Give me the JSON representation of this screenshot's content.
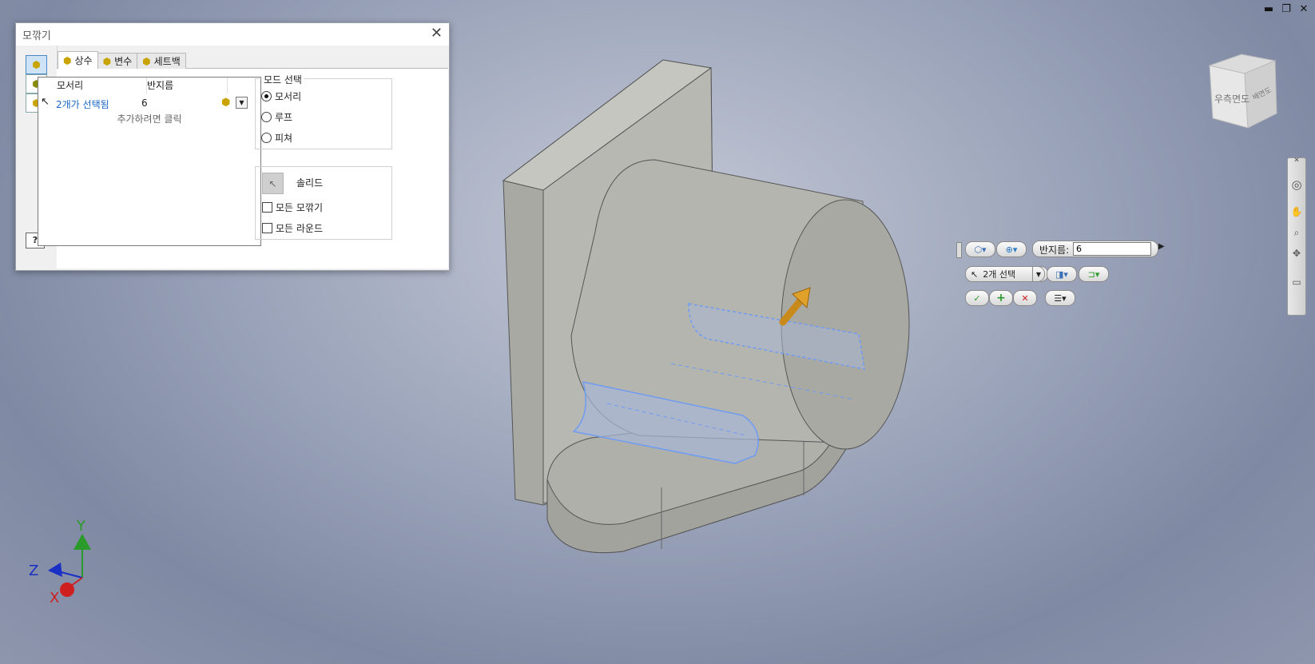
{
  "dialog": {
    "title": "모깎기",
    "tabs": [
      {
        "label": "상수"
      },
      {
        "label": "변수"
      },
      {
        "label": "세트백"
      }
    ],
    "table": {
      "col_edge": "모서리",
      "col_radius": "반지름",
      "rows": [
        {
          "edge": "2개가 선택됨",
          "radius": "6"
        }
      ],
      "add_hint": "추가하려면 클릭"
    },
    "mode": {
      "legend": "모드 선택",
      "options": [
        {
          "label": "모서리",
          "selected": true
        },
        {
          "label": "루프",
          "selected": false
        },
        {
          "label": "피쳐",
          "selected": false
        }
      ]
    },
    "solid": {
      "label": "솔리드",
      "all_fillets": "모든 모깎기",
      "all_rounds": "모든 라운드"
    },
    "help": "?"
  },
  "minitoolbar": {
    "radius_label": "반지름:",
    "radius_value": "6",
    "select_label": "2개 선택",
    "ok": "✓",
    "add": "+",
    "cancel": "✕"
  },
  "viewcube": {
    "face_front": "우측면도",
    "face_side": "배면도"
  },
  "triad": {
    "x": "X",
    "y": "Y",
    "z": "Z"
  },
  "colors": {
    "accent": "#1a66c4",
    "selection": "#6f9bf2",
    "x_axis": "#d01f1f",
    "y_axis": "#2a9a2a",
    "z_axis": "#1a2fc4"
  }
}
